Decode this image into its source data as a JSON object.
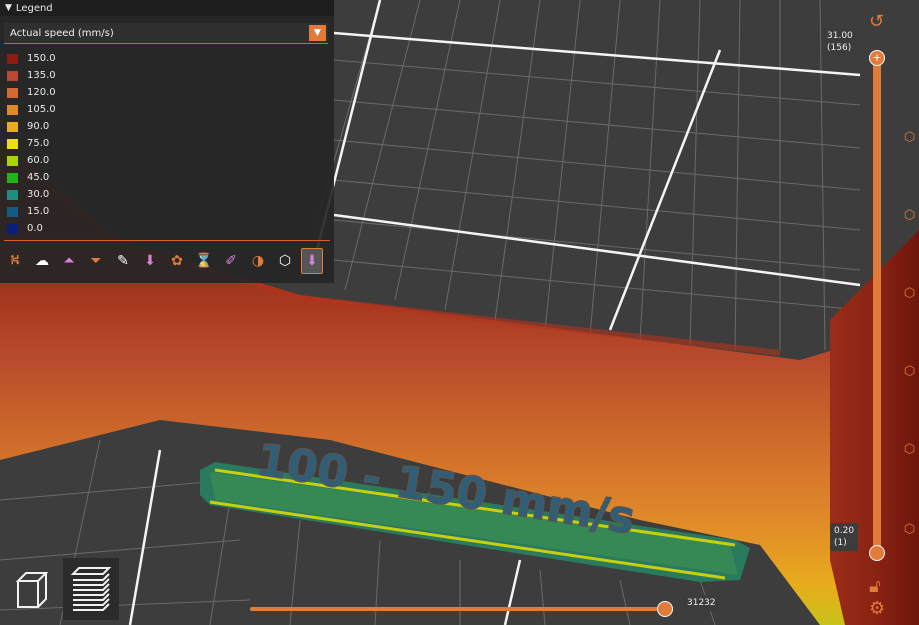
{
  "legend": {
    "title": "Legend",
    "metric": "Actual speed (mm/s)",
    "items": [
      {
        "value": "150.0",
        "color": "#8e1c12"
      },
      {
        "value": "135.0",
        "color": "#b84a34"
      },
      {
        "value": "120.0",
        "color": "#d16a33"
      },
      {
        "value": "105.0",
        "color": "#e0892a"
      },
      {
        "value": "90.0",
        "color": "#e8ac1c"
      },
      {
        "value": "75.0",
        "color": "#f0df10"
      },
      {
        "value": "60.0",
        "color": "#a7d50a"
      },
      {
        "value": "45.0",
        "color": "#22b414"
      },
      {
        "value": "30.0",
        "color": "#1d8f80"
      },
      {
        "value": "15.0",
        "color": "#135b86"
      },
      {
        "value": "0.0",
        "color": "#0a1f7a"
      }
    ],
    "toolbar": [
      {
        "name": "travel-icon",
        "glyph": "⛕"
      },
      {
        "name": "wipe-icon",
        "glyph": "☁"
      },
      {
        "name": "retractions-icon",
        "glyph": "⏶"
      },
      {
        "name": "deretractions-icon",
        "glyph": "⏷"
      },
      {
        "name": "seams-icon",
        "glyph": "✎"
      },
      {
        "name": "tool-changes-icon",
        "glyph": "⬇"
      },
      {
        "name": "color-changes-icon",
        "glyph": "✿"
      },
      {
        "name": "pause-prints-icon",
        "glyph": "⌛"
      },
      {
        "name": "custom-gcodes-icon",
        "glyph": "✐"
      },
      {
        "name": "center-of-gravity-icon",
        "glyph": "◑"
      },
      {
        "name": "shells-icon",
        "glyph": "⬡"
      },
      {
        "name": "tool-marker-icon",
        "glyph": "⬇"
      }
    ]
  },
  "layers_slider": {
    "top_value": "31.00",
    "top_layer": "(156)",
    "bottom_value": "0.20",
    "bottom_layer": "(1)",
    "plus_glyph": "+"
  },
  "moves_slider": {
    "value": "31232"
  },
  "scene": {
    "embossed_text": "100 - 150 mm/s"
  },
  "colors": {
    "accent": "#e07b39",
    "panel_bg": "#262626",
    "bed_grid": "#ffffff"
  }
}
